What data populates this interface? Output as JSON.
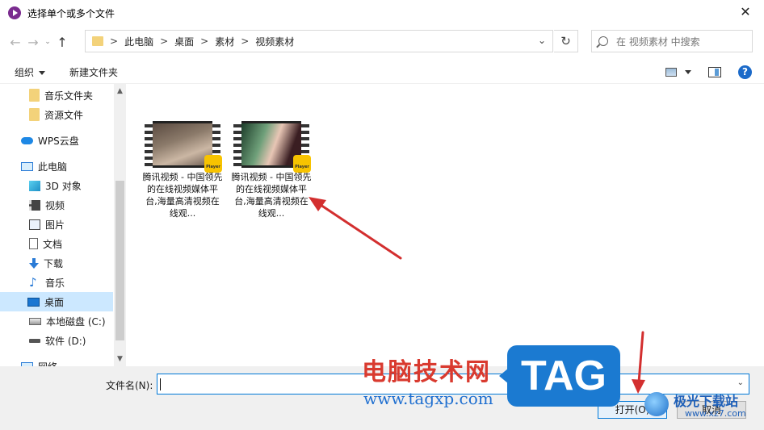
{
  "window": {
    "title": "选择单个或多个文件",
    "close_glyph": "✕"
  },
  "nav": {
    "back_glyph": "←",
    "forward_glyph": "→",
    "up_glyph": "↑",
    "crumbs": [
      "此电脑",
      "桌面",
      "素材",
      "视频素材"
    ],
    "crumb_sep": ">",
    "refresh_glyph": "↻",
    "dropdown_glyph": "⌄",
    "search_placeholder": "在 视频素材 中搜索"
  },
  "toolbar": {
    "organize": "组织",
    "new_folder": "新建文件夹",
    "help": "?"
  },
  "sidebar": {
    "items": [
      {
        "label": "音乐文件夹",
        "icon": "folder-icon"
      },
      {
        "label": "资源文件",
        "icon": "folder-icon"
      },
      {
        "label": "WPS云盘",
        "icon": "cloud-icon"
      },
      {
        "label": "此电脑",
        "icon": "computer-icon"
      },
      {
        "label": "3D 对象",
        "icon": "cube-icon"
      },
      {
        "label": "视频",
        "icon": "video-icon"
      },
      {
        "label": "图片",
        "icon": "picture-icon"
      },
      {
        "label": "文档",
        "icon": "document-icon"
      },
      {
        "label": "下载",
        "icon": "download-icon"
      },
      {
        "label": "音乐",
        "icon": "music-icon"
      },
      {
        "label": "桌面",
        "icon": "desktop-icon"
      },
      {
        "label": "本地磁盘 (C:)",
        "icon": "disk-icon"
      },
      {
        "label": "软件 (D:)",
        "icon": "disk-icon"
      },
      {
        "label": "网络",
        "icon": "network-icon"
      }
    ],
    "scroll_up": "▲",
    "scroll_down": "▼"
  },
  "files": [
    {
      "name": "腾讯视频 - 中国领先的在线视频媒体平台,海量高清视频在线观...",
      "badge": "Player",
      "icon": "video-file-icon"
    },
    {
      "name": "腾讯视频 - 中国领先的在线视频媒体平台,海量高清视频在线观...",
      "badge": "Player",
      "icon": "video-file-icon"
    }
  ],
  "footer": {
    "filename_label": "文件名(N):",
    "filename_value": "",
    "open": "打开(O)",
    "cancel": "取消"
  },
  "watermark": {
    "text": "电脑技术网",
    "url": "www.tagxp.com",
    "tag": "TAG",
    "site_name": "极光下载站",
    "site_url": "www.xz7.com"
  },
  "colors": {
    "accent": "#0078d7",
    "selection": "#cce8ff",
    "annotation_red": "#d32f2f"
  }
}
